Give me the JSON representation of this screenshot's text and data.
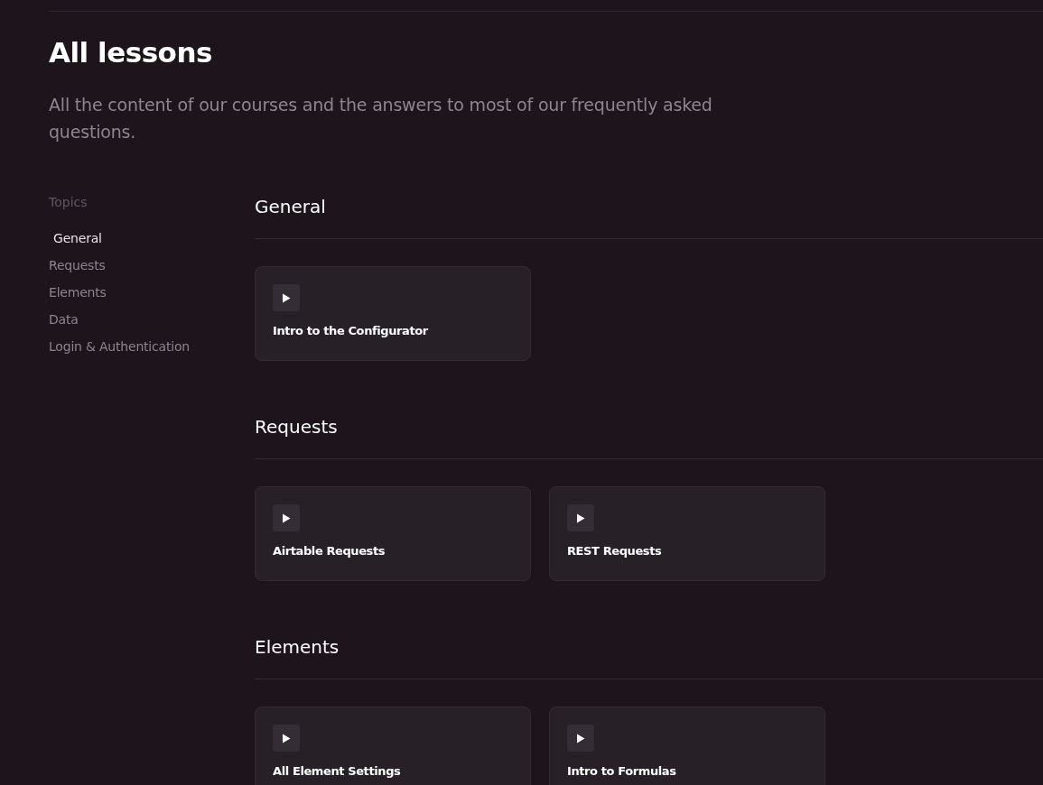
{
  "title": "All lessons",
  "subtitle": "All the content of our courses and the answers to most of our frequently asked questions.",
  "sidebar": {
    "heading": "Topics",
    "items": [
      {
        "label": "General",
        "selected": true
      },
      {
        "label": "Requests",
        "selected": false
      },
      {
        "label": "Elements",
        "selected": false
      },
      {
        "label": "Data",
        "selected": false
      },
      {
        "label": "Login & Authentication",
        "selected": false
      }
    ]
  },
  "sections": [
    {
      "heading": "General",
      "lessons": [
        {
          "title": "Intro to the Configurator"
        }
      ]
    },
    {
      "heading": "Requests",
      "lessons": [
        {
          "title": "Airtable Requests"
        },
        {
          "title": "REST Requests"
        }
      ]
    },
    {
      "heading": "Elements",
      "lessons": [
        {
          "title": "All Element Settings"
        },
        {
          "title": "Intro to Formulas"
        }
      ]
    }
  ]
}
